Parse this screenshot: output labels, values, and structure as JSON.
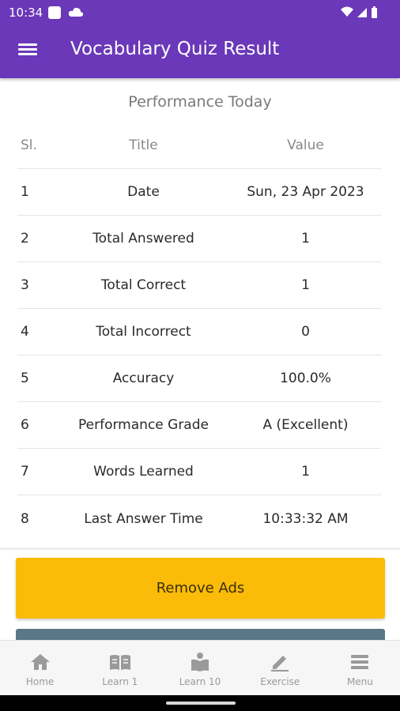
{
  "status_bar": {
    "time": "10:34"
  },
  "app_bar": {
    "title": "Vocabulary Quiz Result"
  },
  "section_title": "Performance Today",
  "table": {
    "headers": [
      "Sl.",
      "Title",
      "Value"
    ],
    "rows": [
      [
        "1",
        "Date",
        "Sun, 23 Apr 2023"
      ],
      [
        "2",
        "Total Answered",
        "1"
      ],
      [
        "3",
        "Total Correct",
        "1"
      ],
      [
        "4",
        "Total Incorrect",
        "0"
      ],
      [
        "5",
        "Accuracy",
        "100.0%"
      ],
      [
        "6",
        "Performance Grade",
        "A (Excellent)"
      ],
      [
        "7",
        "Words Learned",
        "1"
      ],
      [
        "8",
        "Last Answer Time",
        "10:33:32 AM"
      ]
    ]
  },
  "buttons": {
    "remove_ads": "Remove Ads"
  },
  "bottom_nav": [
    {
      "label": "Home",
      "icon": "home-icon"
    },
    {
      "label": "Learn 1",
      "icon": "book-icon"
    },
    {
      "label": "Learn 10",
      "icon": "reader-icon"
    },
    {
      "label": "Exercise",
      "icon": "pencil-icon"
    },
    {
      "label": "Menu",
      "icon": "menu-icon"
    }
  ],
  "colors": {
    "app_bar": "#6a38b8",
    "remove_ads_button": "#fbbc09",
    "secondary_button": "#5a7787",
    "nav_inactive": "#9a9a9a"
  }
}
